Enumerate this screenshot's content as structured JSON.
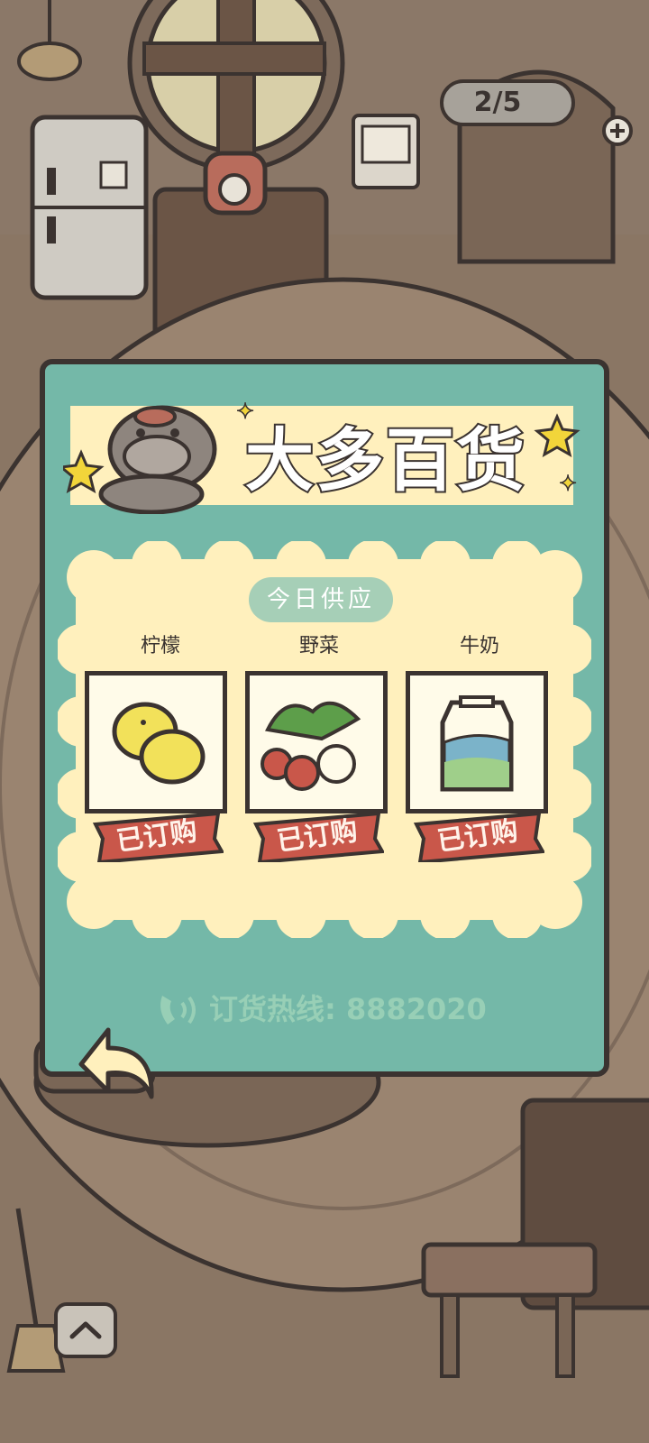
{
  "hud": {
    "counter": "2/5",
    "plus_icon": "plus-icon"
  },
  "shop": {
    "title": "大多百货",
    "supply_header": "今日供应",
    "items": [
      {
        "name": "柠檬",
        "status": "已订购",
        "icon": "lemon-icon"
      },
      {
        "name": "野菜",
        "status": "已订购",
        "icon": "vegetable-icon"
      },
      {
        "name": "牛奶",
        "status": "已订购",
        "icon": "milk-carton-icon"
      }
    ],
    "hotline": "订货热线: 8882020",
    "hotline_icon": "phone-icon"
  },
  "nav": {
    "back_icon": "back-arrow-icon",
    "up_icon": "chevron-up-icon"
  },
  "colors": {
    "panel_teal": "#74b8a8",
    "cream": "#fff0bd",
    "stamp_red": "#c9574a",
    "outline": "#3b3330",
    "hotline_green": "#98cfb6"
  }
}
